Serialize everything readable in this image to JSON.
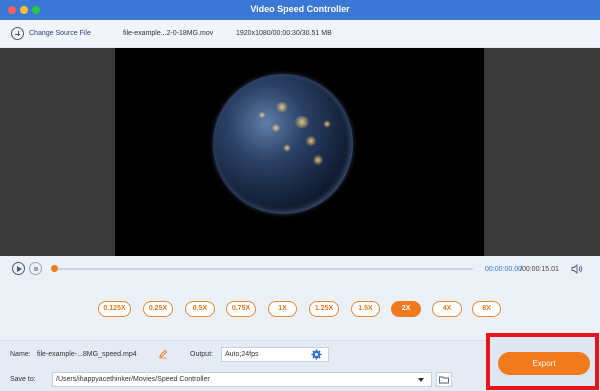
{
  "window": {
    "title": "Video Speed Controller"
  },
  "topbar": {
    "change_source_label": "Change Source File",
    "file_name": "file-example...2-0-18MG.mov",
    "file_meta": "1920x1080/00:00:30/30.51 MB"
  },
  "player": {
    "current_time": "00:00:00.00",
    "total_time": "/00:00:15.01",
    "progress": 0.0
  },
  "speeds": {
    "options": [
      "0.125X",
      "0.25X",
      "0.5X",
      "0.75X",
      "1X",
      "1.25X",
      "1.5X",
      "2X",
      "4X",
      "8X"
    ],
    "selected": "2X"
  },
  "bottom": {
    "name_label": "Name:",
    "name_value": "file-example-...8MG_speed.mp4",
    "output_label": "Output:",
    "output_value": "Auto;24fps",
    "save_label": "Save to:",
    "save_path": "/Users/ihappyacethinker/Movies/Speed Controller",
    "export_label": "Export"
  },
  "colors": {
    "titlebar": "#3b78d6",
    "accent_orange": "#f07a1c",
    "highlight_box": "#e8141b"
  }
}
